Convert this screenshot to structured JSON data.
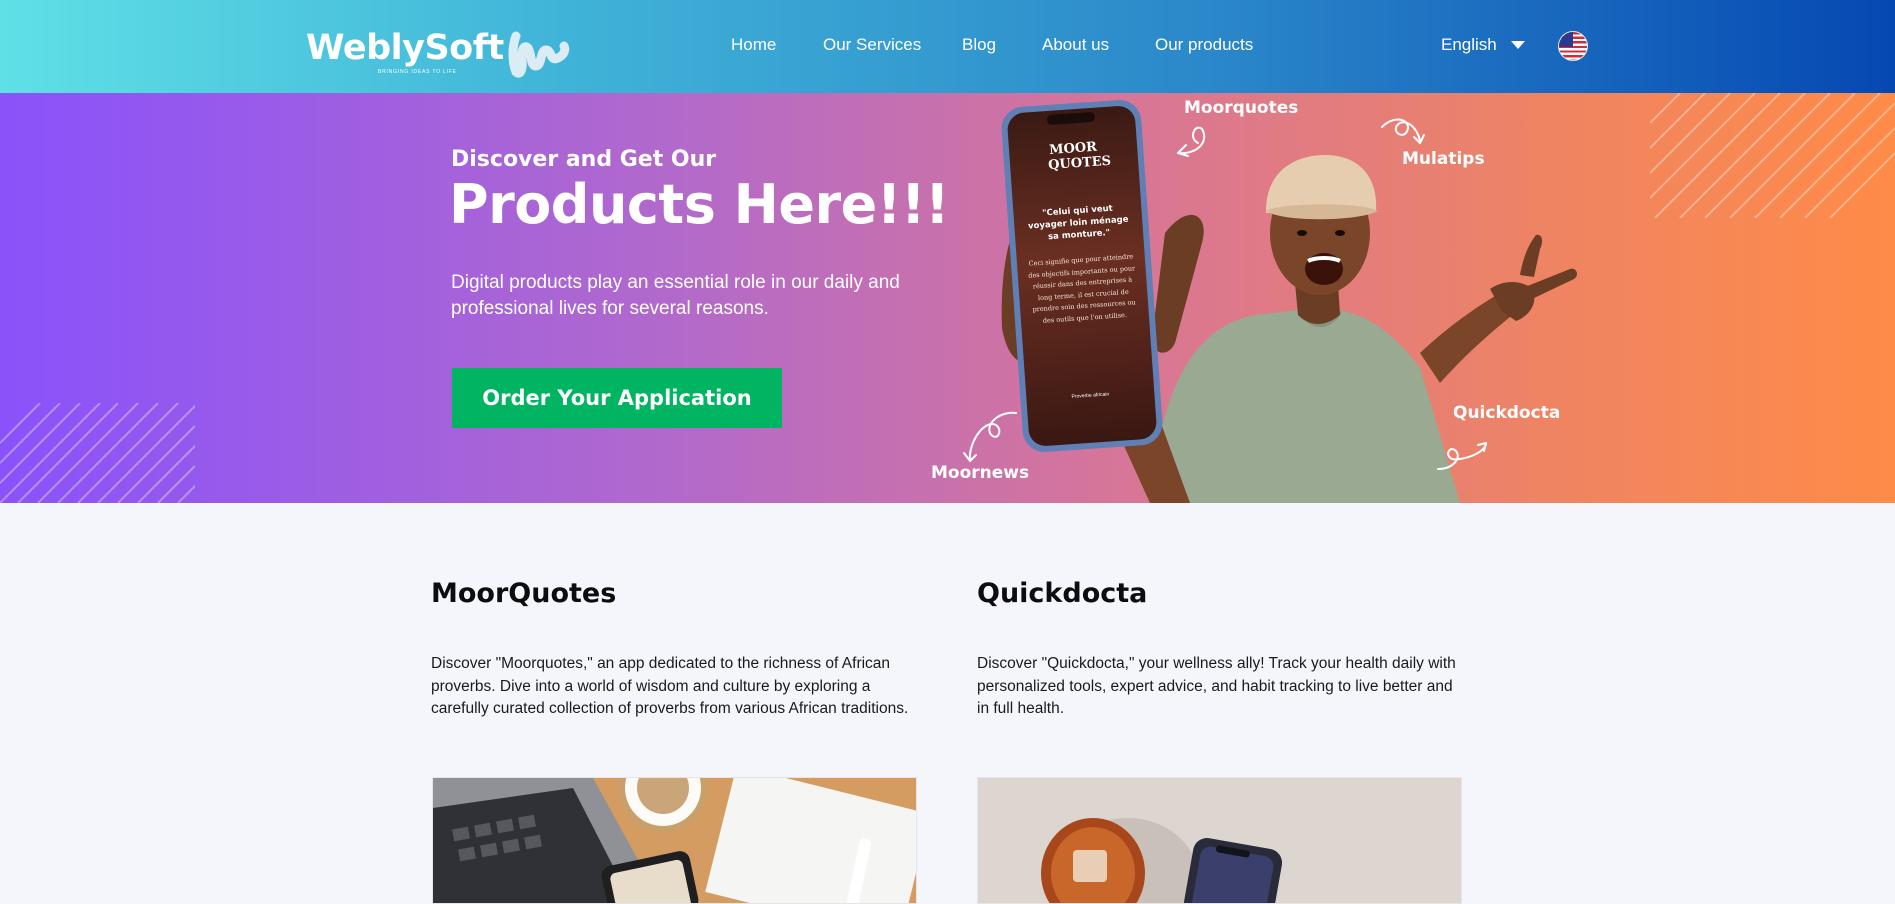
{
  "header": {
    "logo": {
      "name": "WeblySoft",
      "tagline": "BRINGING IDEAS TO LIFE"
    },
    "nav": [
      {
        "label": "Home"
      },
      {
        "label": "Our Services"
      },
      {
        "label": "Blog"
      },
      {
        "label": "About us"
      },
      {
        "label": "Our products"
      }
    ],
    "language": {
      "selected": "English",
      "flag_icon": "us-flag-icon"
    }
  },
  "hero": {
    "subtitle": "Discover and Get Our",
    "title": "Products Here!!!",
    "description": "Digital products play an essential role in our daily and professional lives for several reasons.",
    "cta_label": "Order Your Application",
    "cta_color": "#00b461",
    "app_labels": [
      "Moorquotes",
      "Mulatips",
      "Quickdocta",
      "Moornews"
    ],
    "phone_screen": {
      "logo": "MOOR QUOTES",
      "quote": "\"Celui qui veut voyager loin ménage sa monture.\"",
      "explanation": "Ceci signifie que pour atteindre des objectifs importants ou pour réussir dans des entreprises à long terme, il est crucial de prendre soin des ressources ou des outils que l'on utilise.",
      "footer": "Proverbe africain"
    }
  },
  "products": [
    {
      "title": "MoorQuotes",
      "description": "Discover \"Moorquotes,\" an app dedicated to the richness of African proverbs. Dive into a world of wisdom and culture by exploring a carefully curated collection of proverbs from various African traditions."
    },
    {
      "title": "Quickdocta",
      "description": "Discover \"Quickdocta,\" your wellness ally! Track your health daily with personalized tools, expert advice, and habit tracking to live better and in full health."
    }
  ],
  "colors": {
    "header_start": "#5fe0e6",
    "header_end": "#0648b2",
    "hero_start": "#8a52fb",
    "hero_end": "#ff8b48"
  }
}
